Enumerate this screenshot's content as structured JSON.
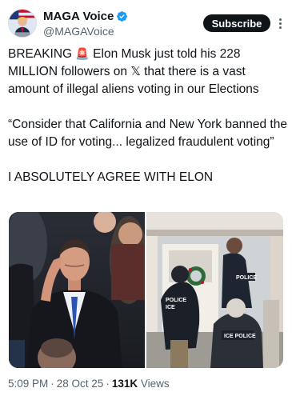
{
  "author": {
    "display_name": "MAGA Voice",
    "handle": "@MAGAVoice",
    "verified_icon": "verified-badge-icon",
    "avatar_icon": "flag-portrait-avatar"
  },
  "actions": {
    "subscribe_label": "Subscribe",
    "more_icon": "more-options-icon"
  },
  "post": {
    "line1_before": "BREAKING ",
    "siren": "🚨",
    "line1_after": " Elon Musk just told his 228 MILLION followers on 𝕏 that there is a vast amount of illegal aliens voting in our Elections",
    "quote": "“Consider that California and New York banned the use of ID for voting... legalized fraudulent voting”",
    "closing": "I ABSOLUTELY AGREE WITH ELON"
  },
  "media": {
    "left_photo": "man-saluting-photo",
    "right_photo": "ice-agents-at-door-photo",
    "vest_label_1": "POLICE",
    "vest_label_2": "ICE",
    "vest_label_3": "POLICE",
    "vest_label_4": "ICE POLICE"
  },
  "meta": {
    "time": "5:09 PM",
    "date": "28 Oct 25",
    "views_count": "131K",
    "views_label": "Views",
    "separator": "·"
  },
  "colors": {
    "text": "#0f1419",
    "secondary": "#536471",
    "verified": "#1d9bf0",
    "subscribe_bg": "#0f1419"
  }
}
